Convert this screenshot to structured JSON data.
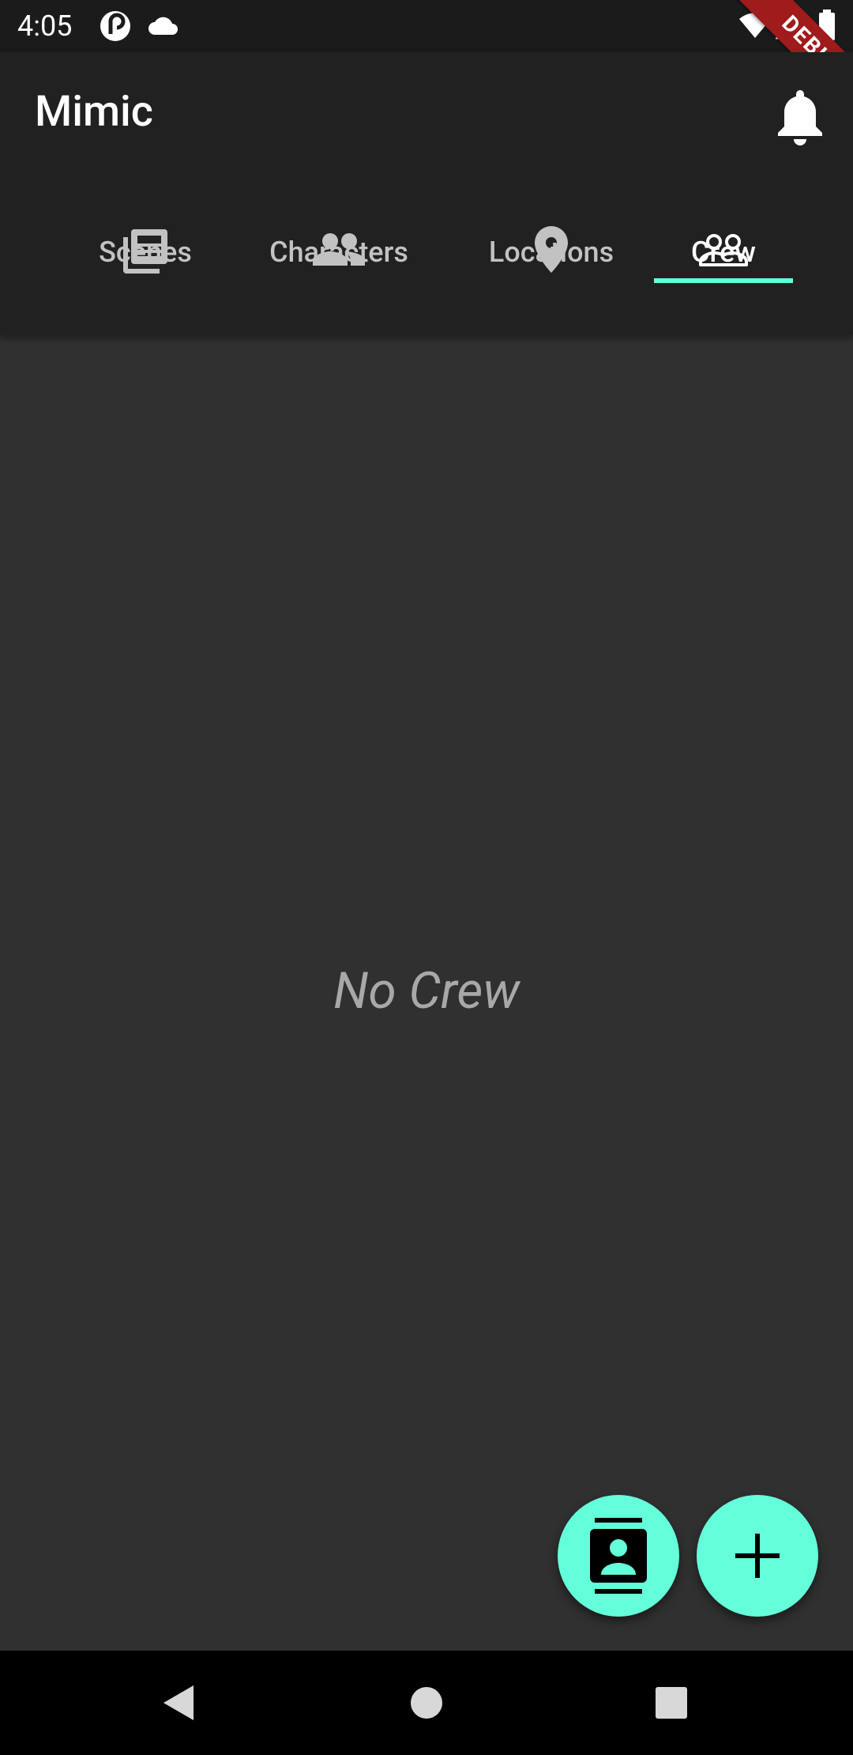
{
  "status_bar": {
    "time": "4:05",
    "icons": [
      "pocketcasts-icon",
      "cloud-icon",
      "wifi-icon",
      "signal-icon",
      "battery-icon"
    ]
  },
  "app_bar": {
    "title": "Mimic",
    "action_icon": "bell-icon"
  },
  "tabs": [
    {
      "label": "Scenes",
      "icon": "newspaper-icon",
      "active": false
    },
    {
      "label": "Characters",
      "icon": "people-icon",
      "active": false
    },
    {
      "label": "Locations",
      "icon": "location-pin-icon",
      "active": false
    },
    {
      "label": "Crew",
      "icon": "people-outline-icon",
      "active": true
    }
  ],
  "empty_state": {
    "text": "No Crew"
  },
  "fabs": [
    {
      "icon": "contacts-icon"
    },
    {
      "icon": "add-icon"
    }
  ],
  "nav_bar": {
    "buttons": [
      "back-icon",
      "home-icon",
      "recents-icon"
    ]
  },
  "debug_banner": "DEBUG",
  "colors": {
    "accent": "#64ffda",
    "app_bar": "#212121",
    "background": "#303030",
    "status_bar": "#1b1b1b",
    "debug": "#a01b1b"
  }
}
